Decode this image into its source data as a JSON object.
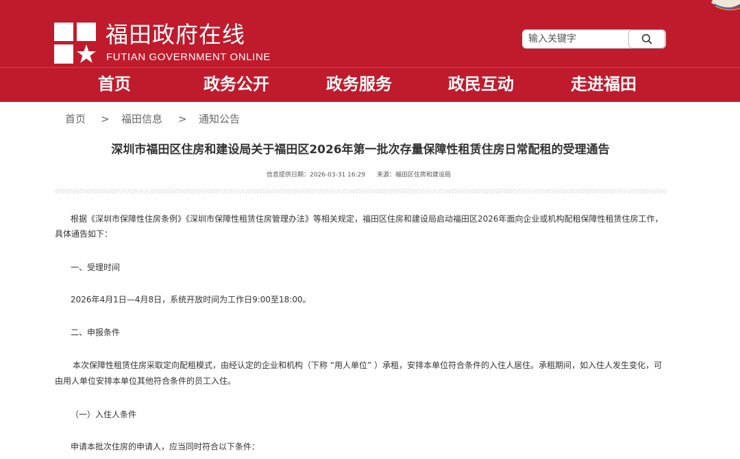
{
  "header": {
    "site_name": "福田政府在线",
    "site_name_en": "FUTIAN GOVERNMENT ONLINE",
    "brand_color": "#c01b2c"
  },
  "search": {
    "placeholder": "输入关键字",
    "button_icon": "search-icon"
  },
  "nav": {
    "items": [
      "首页",
      "政务公开",
      "政务服务",
      "政民互动",
      "走进福田"
    ]
  },
  "breadcrumb": {
    "items": [
      "首页",
      "福田信息",
      "通知公告"
    ],
    "separator": ">"
  },
  "article": {
    "title": "深圳市福田区住房和建设局关于福田区2026年第一批次存量保障性租赁住房日常配租的受理通告",
    "info_date": "信息提供日期：2026-03-31 16:29",
    "source": "来源：福田区住房和建设局",
    "paragraphs": [
      "根据《深圳市保障性住房条例》《深圳市保障性租赁住房管理办法》等相关规定，福田区住房和建设局启动福田区2026年面向企业或机构配租保障性租赁住房工作，",
      "具体通告如下：",
      "一、受理时间",
      "2026年4月1日—4月8日，系统开放时间为工作日9:00至18:00。",
      "二、申报条件",
      "本次保障性租赁住房采取定向配租模式，由经认定的企业和机构（下称 “用人单位” ）承租，安排本单位符合条件的入住人居住。承租期间，如入住人发生变化，可",
      "由用人单位安排本单位其他符合条件的员工入住。",
      "（一）入住人条件",
      "申请本批次住房的申请人，应当同时符合以下条件："
    ]
  }
}
